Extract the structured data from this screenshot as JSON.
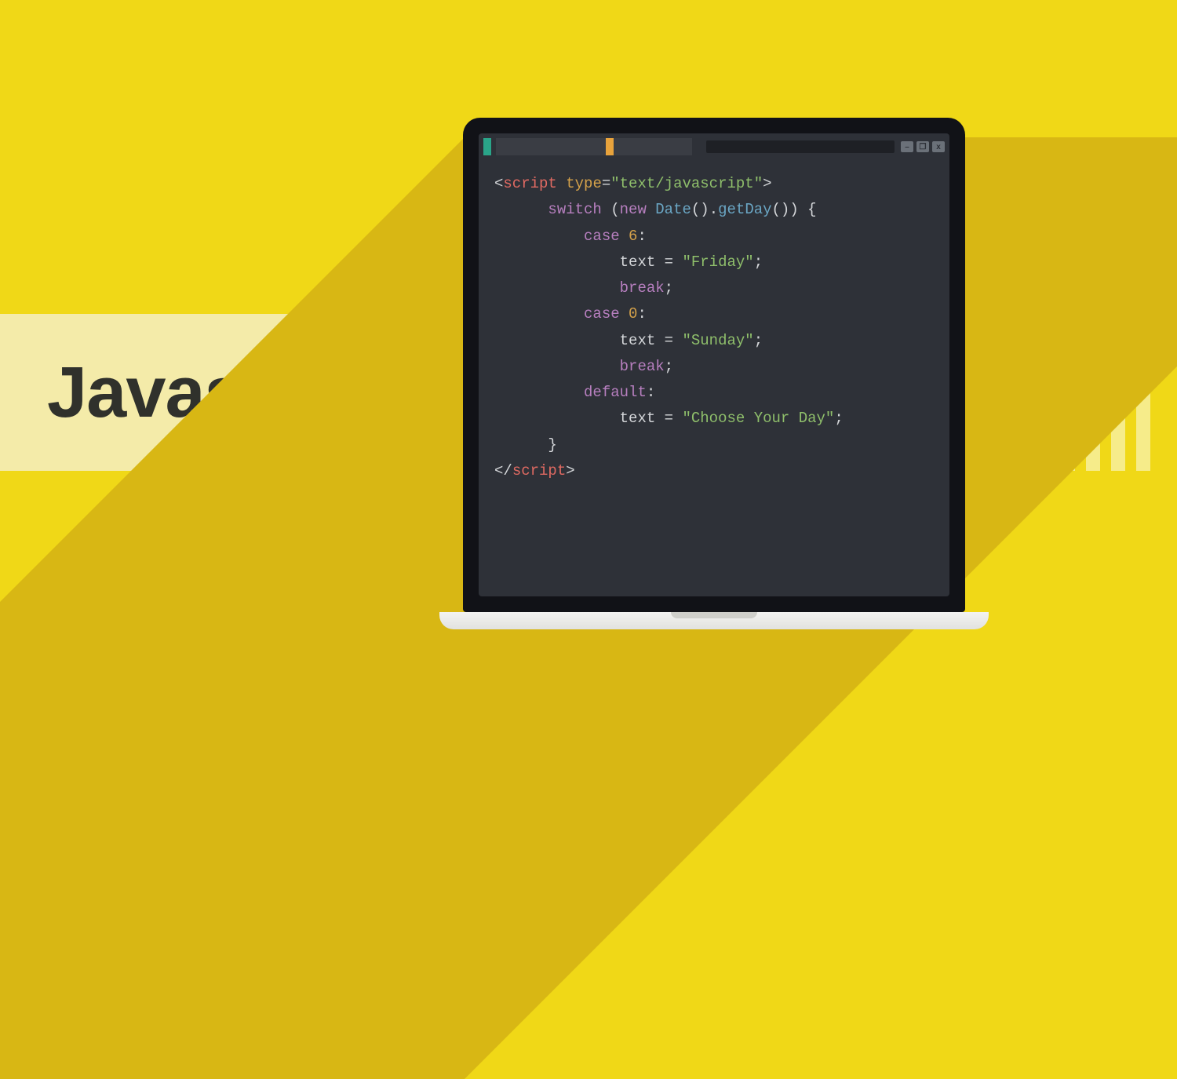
{
  "title": "Javascript",
  "window_controls": {
    "min": "–",
    "max": "❐",
    "close": "x"
  },
  "code": {
    "l1": {
      "open": "<",
      "tag": "script",
      "sp": " ",
      "attr": "type",
      "eq": "=",
      "q1": "\"",
      "val": "text/javascript",
      "q2": "\"",
      "close": ">"
    },
    "l2": {
      "kw": "switch",
      "sp": " (",
      "new": "new",
      "sp2": " ",
      "cls": "Date",
      "paren": "().",
      "fn": "getDay",
      "end": "()) {"
    },
    "l3": {
      "kw": "case",
      "sp": " ",
      "num": "6",
      "colon": ":"
    },
    "l4": {
      "id": "text",
      "sp": " = ",
      "q1": "\"",
      "val": "Friday",
      "q2": "\"",
      "semi": ";"
    },
    "l5": {
      "kw": "break",
      "semi": ";"
    },
    "l6": {
      "kw": "case",
      "sp": " ",
      "num": "0",
      "colon": ":"
    },
    "l7": {
      "id": "text",
      "sp": " = ",
      "q1": "\"",
      "val": "Sunday",
      "q2": "\"",
      "semi": ";"
    },
    "l8": {
      "kw": "break",
      "semi": ";"
    },
    "l9": {
      "kw": "default",
      "colon": ":"
    },
    "l10": {
      "id": "text",
      "sp": " = ",
      "q1": "\"",
      "val": "Choose Your Day",
      "q2": "\"",
      "semi": ";"
    },
    "l11": {
      "brace": "}"
    },
    "l12": {
      "open": "</",
      "tag": "script",
      "close": ">"
    }
  }
}
